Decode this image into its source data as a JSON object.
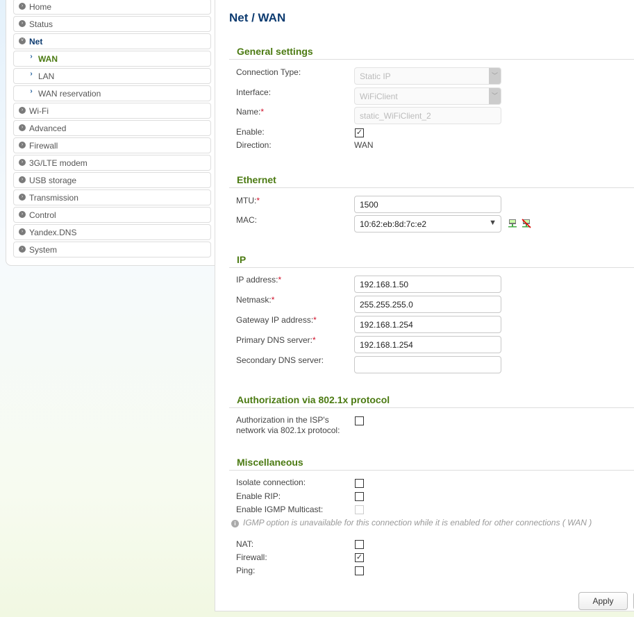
{
  "sidebar": {
    "items": [
      {
        "label": "Home"
      },
      {
        "label": "Status"
      },
      {
        "label": "Net"
      },
      {
        "label": "WAN"
      },
      {
        "label": "LAN"
      },
      {
        "label": "WAN reservation"
      },
      {
        "label": "Wi-Fi"
      },
      {
        "label": "Advanced"
      },
      {
        "label": "Firewall"
      },
      {
        "label": "3G/LTE modem"
      },
      {
        "label": "USB storage"
      },
      {
        "label": "Transmission"
      },
      {
        "label": "Control"
      },
      {
        "label": "Yandex.DNS"
      },
      {
        "label": "System"
      }
    ]
  },
  "page": {
    "title": "Net /  WAN"
  },
  "general": {
    "header": "General settings",
    "conn_type_label": "Connection Type:",
    "conn_type": "Static IP",
    "interface_label": "Interface:",
    "interface": "WiFiClient",
    "name_label": "Name:",
    "name": "static_WiFiClient_2",
    "enable_label": "Enable:",
    "enable": true,
    "direction_label": "Direction:",
    "direction": "WAN"
  },
  "ethernet": {
    "header": "Ethernet",
    "mtu_label": "MTU:",
    "mtu": "1500",
    "mac_label": "MAC:",
    "mac": "10:62:eb:8d:7c:e2"
  },
  "ip": {
    "header": "IP",
    "ip_label": "IP address:",
    "ip": "192.168.1.50",
    "mask_label": "Netmask:",
    "mask": "255.255.255.0",
    "gw_label": "Gateway IP address:",
    "gw": "192.168.1.254",
    "dns1_label": "Primary DNS server:",
    "dns1": "192.168.1.254",
    "dns2_label": "Secondary DNS server:",
    "dns2": ""
  },
  "auth": {
    "header": "Authorization via 802.1x protocol",
    "label1": "Authorization in the ISP's",
    "label2": "network via 802.1x protocol:",
    "checked": false
  },
  "misc": {
    "header": "Miscellaneous",
    "isolate_label": "Isolate connection:",
    "rip_label": "Enable RIP:",
    "igmp_label": "Enable IGMP Multicast:",
    "note": "IGMP option is unavailable for this connection while it is enabled for other connections ( WAN )",
    "nat_label": "NAT:",
    "firewall_label": "Firewall:",
    "firewall": true,
    "ping_label": "Ping:"
  },
  "actions": {
    "apply": "Apply"
  },
  "colors": {
    "title": "#0d3b70",
    "section": "#4b7a12",
    "active": "#4b7a12",
    "required": "#d0102a"
  }
}
